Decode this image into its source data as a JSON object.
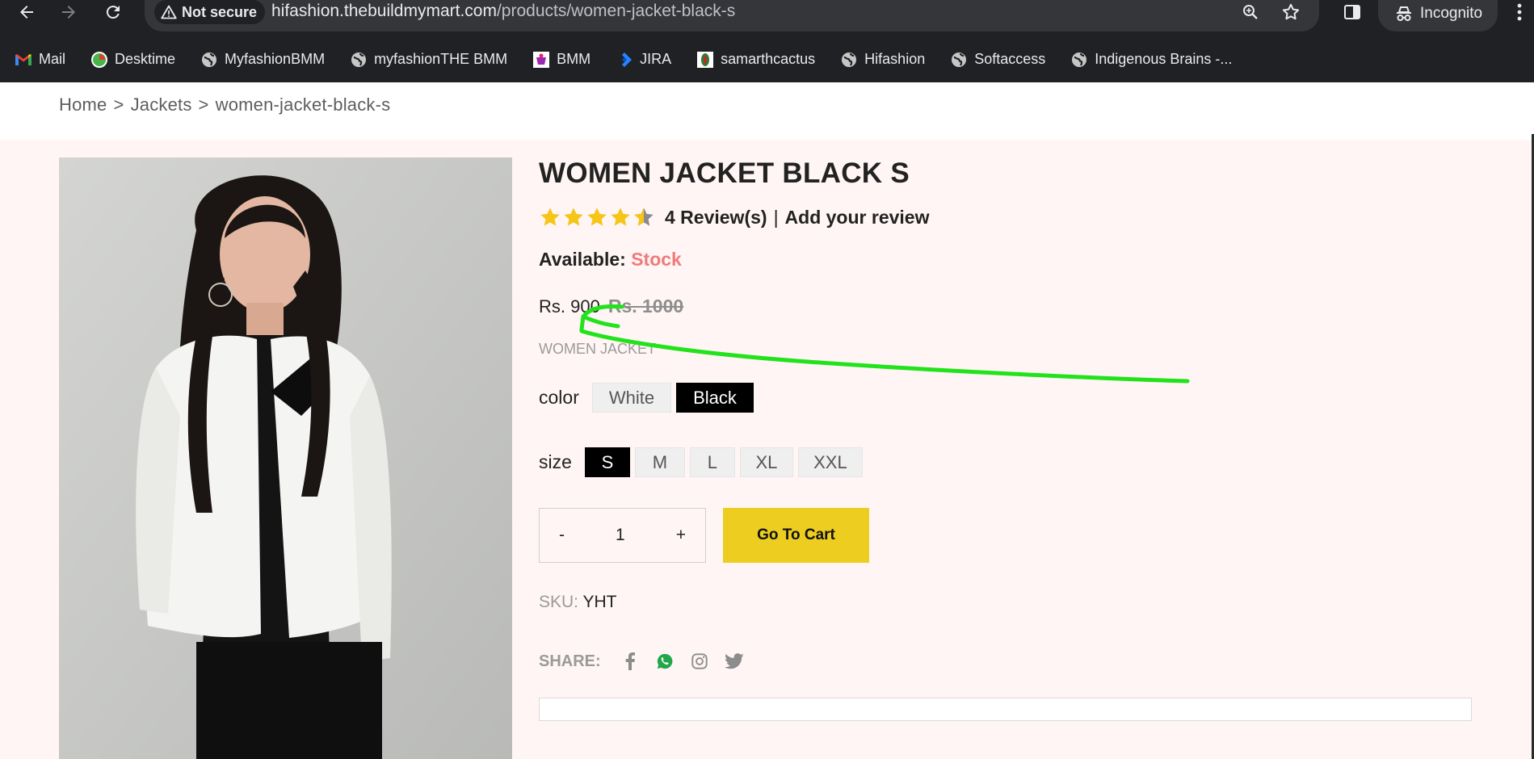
{
  "browser": {
    "security_label": "Not secure",
    "url_host": "hifashion.thebuildmymart.com",
    "url_path": "/products/women-jacket-black-s",
    "incognito_label": "Incognito"
  },
  "bookmarks": [
    {
      "label": "Mail",
      "icon": "gmail-icon"
    },
    {
      "label": "Desktime",
      "icon": "desktime-icon"
    },
    {
      "label": "MyfashionBMM",
      "icon": "globe-icon"
    },
    {
      "label": "myfashionTHE BMM",
      "icon": "globe-icon"
    },
    {
      "label": "BMM",
      "icon": "bmm-icon"
    },
    {
      "label": "JIRA",
      "icon": "jira-icon"
    },
    {
      "label": "samarthcactus",
      "icon": "cactus-icon"
    },
    {
      "label": "Hifashion",
      "icon": "globe-icon"
    },
    {
      "label": "Softaccess",
      "icon": "globe-icon"
    },
    {
      "label": "Indigenous Brains -...",
      "icon": "globe-icon"
    }
  ],
  "breadcrumb": {
    "home": "Home",
    "sep": ">",
    "category": "Jackets",
    "current": "women-jacket-black-s"
  },
  "product": {
    "title": "WOMEN JACKET BLACK S",
    "rating": 4.5,
    "rating_max": 5,
    "reviews_label": "4 Review(s)",
    "separator": "|",
    "add_review_label": "Add your review",
    "available_label": "Available:",
    "available_value": "Stock",
    "price": "Rs. 900",
    "old_price": "Rs. 1000",
    "subtitle": "WOMEN JACKET",
    "color_label": "color",
    "colors": [
      "White",
      "Black"
    ],
    "selected_color": "Black",
    "size_label": "size",
    "sizes": [
      "S",
      "M",
      "L",
      "XL",
      "XXL"
    ],
    "selected_size": "S",
    "qty_minus": "-",
    "qty_value": "1",
    "qty_plus": "+",
    "cart_label": "Go To Cart",
    "sku_label": "SKU:",
    "sku_value": "YHT",
    "share_label": "SHARE:"
  },
  "colors": {
    "accent_yellow": "#eccd20",
    "stock_red": "#ef7b7b",
    "star": "#f5c518",
    "annotation_green": "#22e31b"
  }
}
